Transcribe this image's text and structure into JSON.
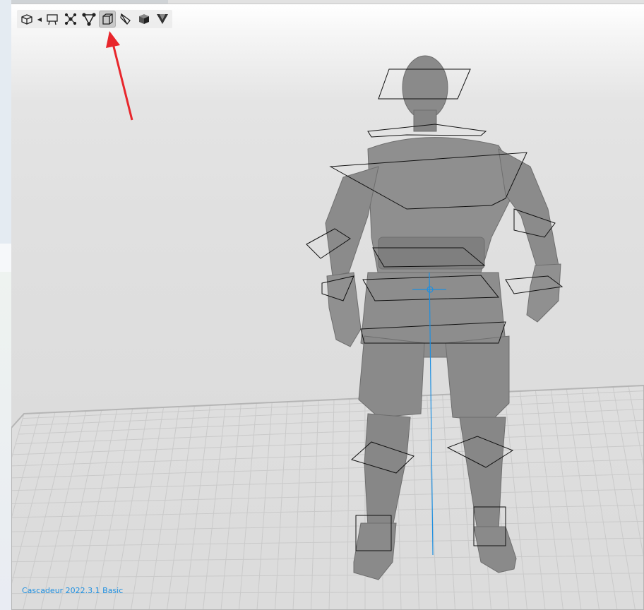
{
  "app": {
    "version_label": "Cascadeur 2022.3.1 Basic"
  },
  "toolbar": {
    "tools": [
      {
        "icon": "object-mode-cube-icon",
        "active": false
      },
      {
        "icon": "rig-display-icon",
        "active": false
      },
      {
        "icon": "joints-icon",
        "active": false
      },
      {
        "icon": "bones-icon",
        "active": false
      },
      {
        "icon": "box-display-icon",
        "active": true
      },
      {
        "icon": "mesh-display-icon",
        "active": false
      },
      {
        "icon": "solid-cube-icon",
        "active": false
      },
      {
        "icon": "shading-icon",
        "active": false
      }
    ]
  },
  "colors": {
    "accent": "#1e8fe0",
    "annotation_arrow": "#e8262c",
    "model": "#8a8a8a",
    "grid": "#c8c8c8"
  }
}
